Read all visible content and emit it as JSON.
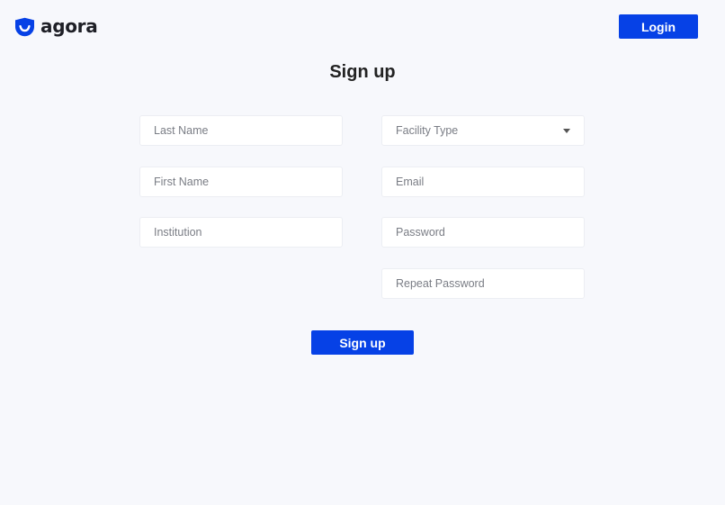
{
  "brand": {
    "name": "agora",
    "icon": "agora-logo-icon",
    "color": "#0641e6"
  },
  "header": {
    "login_label": "Login"
  },
  "page": {
    "title": "Sign up"
  },
  "form": {
    "last_name": {
      "placeholder": "Last Name",
      "value": ""
    },
    "first_name": {
      "placeholder": "First Name",
      "value": ""
    },
    "institution": {
      "placeholder": "Institution",
      "value": ""
    },
    "facility_type": {
      "placeholder": "Facility Type",
      "icon": "chevron-down-icon"
    },
    "email": {
      "placeholder": "Email",
      "value": ""
    },
    "password": {
      "placeholder": "Password",
      "value": ""
    },
    "repeat_password": {
      "placeholder": "Repeat Password",
      "value": ""
    },
    "submit_label": "Sign up"
  },
  "colors": {
    "background": "#f7f8fc",
    "primary": "#0641e6",
    "field_background": "#ffffff",
    "placeholder_text": "#7a7d85"
  }
}
